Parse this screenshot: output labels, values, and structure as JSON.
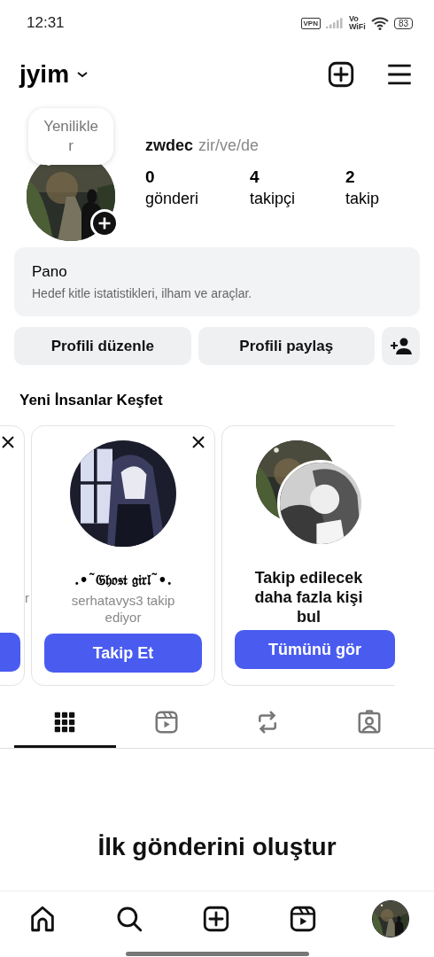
{
  "status_bar": {
    "time": "12:31",
    "vpn": "VPN",
    "vowifi_top": "Vo",
    "vowifi_bottom": "WiFi",
    "battery": "83"
  },
  "header": {
    "username": "jyim"
  },
  "profile": {
    "note": "Yenilikler",
    "name": "zwdec",
    "pronouns": "zir/ve/de",
    "stats": [
      {
        "value": "0",
        "label": "gönderi"
      },
      {
        "value": "4",
        "label": "takipçi"
      },
      {
        "value": "2",
        "label": "takip"
      }
    ]
  },
  "dashboard": {
    "title": "Pano",
    "subtitle": "Hedef kitle istatistikleri, ilham ve araçlar."
  },
  "actions": [
    "Profili düzenle",
    "Profili paylaş"
  ],
  "discover": {
    "title": "Yeni İnsanlar Keşfet",
    "cards": [
      {
        "kind": "partial",
        "subtitle": "r"
      },
      {
        "kind": "person",
        "name": ".•˜𝔊𝔥𝔬𝔰𝔱 𝔤𝔦𝔯𝔩˜•.",
        "subtitle": "serhatavys3 takip ediyor",
        "button": "Takip Et"
      },
      {
        "kind": "more",
        "name": "Takip edilecek daha fazla kişi bul",
        "button": "Tümünü gör"
      }
    ]
  },
  "tabs": [
    {
      "kind": "grid",
      "selected": true
    },
    {
      "kind": "reels",
      "selected": false
    },
    {
      "kind": "reposts",
      "selected": false
    },
    {
      "kind": "tagged",
      "selected": false
    }
  ],
  "empty": {
    "title": "İlk gönderini oluştur"
  },
  "nav": [
    {
      "kind": "home"
    },
    {
      "kind": "search"
    },
    {
      "kind": "create"
    },
    {
      "kind": "reels"
    },
    {
      "kind": "profile"
    }
  ]
}
